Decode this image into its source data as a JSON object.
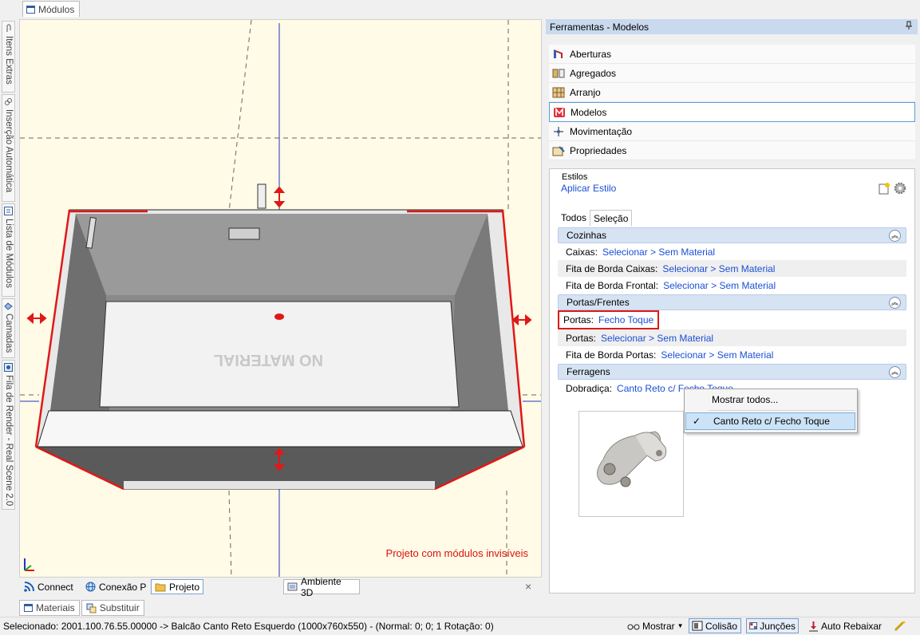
{
  "document_tab": {
    "label": "Módulos"
  },
  "left_tabs": [
    {
      "label": "Itens Extras",
      "icon": "paperclip-icon"
    },
    {
      "label": "Inserção Automática",
      "icon": "chain-icon"
    },
    {
      "label": "Lista de Módulos",
      "icon": "list-icon"
    },
    {
      "label": "Camadas",
      "icon": "layers-icon"
    },
    {
      "label": "Fila de Render - Real Scene 2.0",
      "icon": "render-icon"
    }
  ],
  "viewport": {
    "note": "Projeto com módulos invisíveis",
    "watermark": "NO MATERIAL",
    "note_color": "#dd1111"
  },
  "viewport_tabs": [
    {
      "label": "Connect",
      "icon": "rss-icon"
    },
    {
      "label": "Conexão P",
      "icon": "globe-icon"
    },
    {
      "label": "Projeto",
      "icon": "folder-icon",
      "active": true
    },
    {
      "label": "Ambiente 3D",
      "icon": "cube-icon"
    }
  ],
  "viewport_close": "×",
  "bottom_tabs": [
    {
      "label": "Materiais",
      "icon": "window-icon"
    },
    {
      "label": "Substituir",
      "icon": "replace-icon"
    }
  ],
  "status": {
    "text": "Selecionado: 2001.100.76.55.00000 -> Balcão Canto Reto Esquerdo (1000x760x550) - (Normal: 0; 0; 1 Rotação: 0)",
    "mostrar": "Mostrar",
    "colisao": "Colisão",
    "juncoes": "Junções",
    "auto_rebaixar": "Auto Rebaixar"
  },
  "panel": {
    "title": "Ferramentas - Modelos",
    "pin": "📌",
    "tools": [
      {
        "label": "Aberturas",
        "icon": "door-open-icon"
      },
      {
        "label": "Agregados",
        "icon": "aggregate-icon"
      },
      {
        "label": "Arranjo",
        "icon": "grid-icon"
      },
      {
        "label": "Modelos",
        "icon": "models-icon",
        "selected": true
      },
      {
        "label": "Movimentação",
        "icon": "move-icon"
      },
      {
        "label": "Propriedades",
        "icon": "properties-icon"
      }
    ],
    "estilos_label": "Estilos",
    "aplicar_estilo": "Aplicar Estilo",
    "subtabs": [
      "Todos",
      "Seleção"
    ],
    "groups": [
      {
        "title": "Cozinhas",
        "rows": [
          {
            "label": "Caixas:",
            "value": "Selecionar > Sem Material"
          },
          {
            "label": "Fita de Borda Caixas:",
            "value": "Selecionar > Sem Material"
          },
          {
            "label": "Fita de Borda Frontal:",
            "value": "Selecionar > Sem Material"
          }
        ]
      },
      {
        "title": "Portas/Frentes",
        "rows": [
          {
            "label": "Portas:",
            "value": "Fecho Toque",
            "highlight": true
          },
          {
            "label": "Portas:",
            "value": "Selecionar > Sem Material"
          },
          {
            "label": "Fita de Borda Portas:",
            "value": "Selecionar > Sem Material"
          }
        ]
      },
      {
        "title": "Ferragens",
        "rows": [
          {
            "label": "Dobradiça:",
            "value": "Canto Reto c/ Fecho Toque"
          }
        ]
      }
    ]
  },
  "context_menu": {
    "items": [
      {
        "label": "Mostrar todos..."
      },
      {
        "label": "Canto Reto c/ Fecho Toque",
        "checked": true,
        "check": "✓"
      }
    ]
  }
}
